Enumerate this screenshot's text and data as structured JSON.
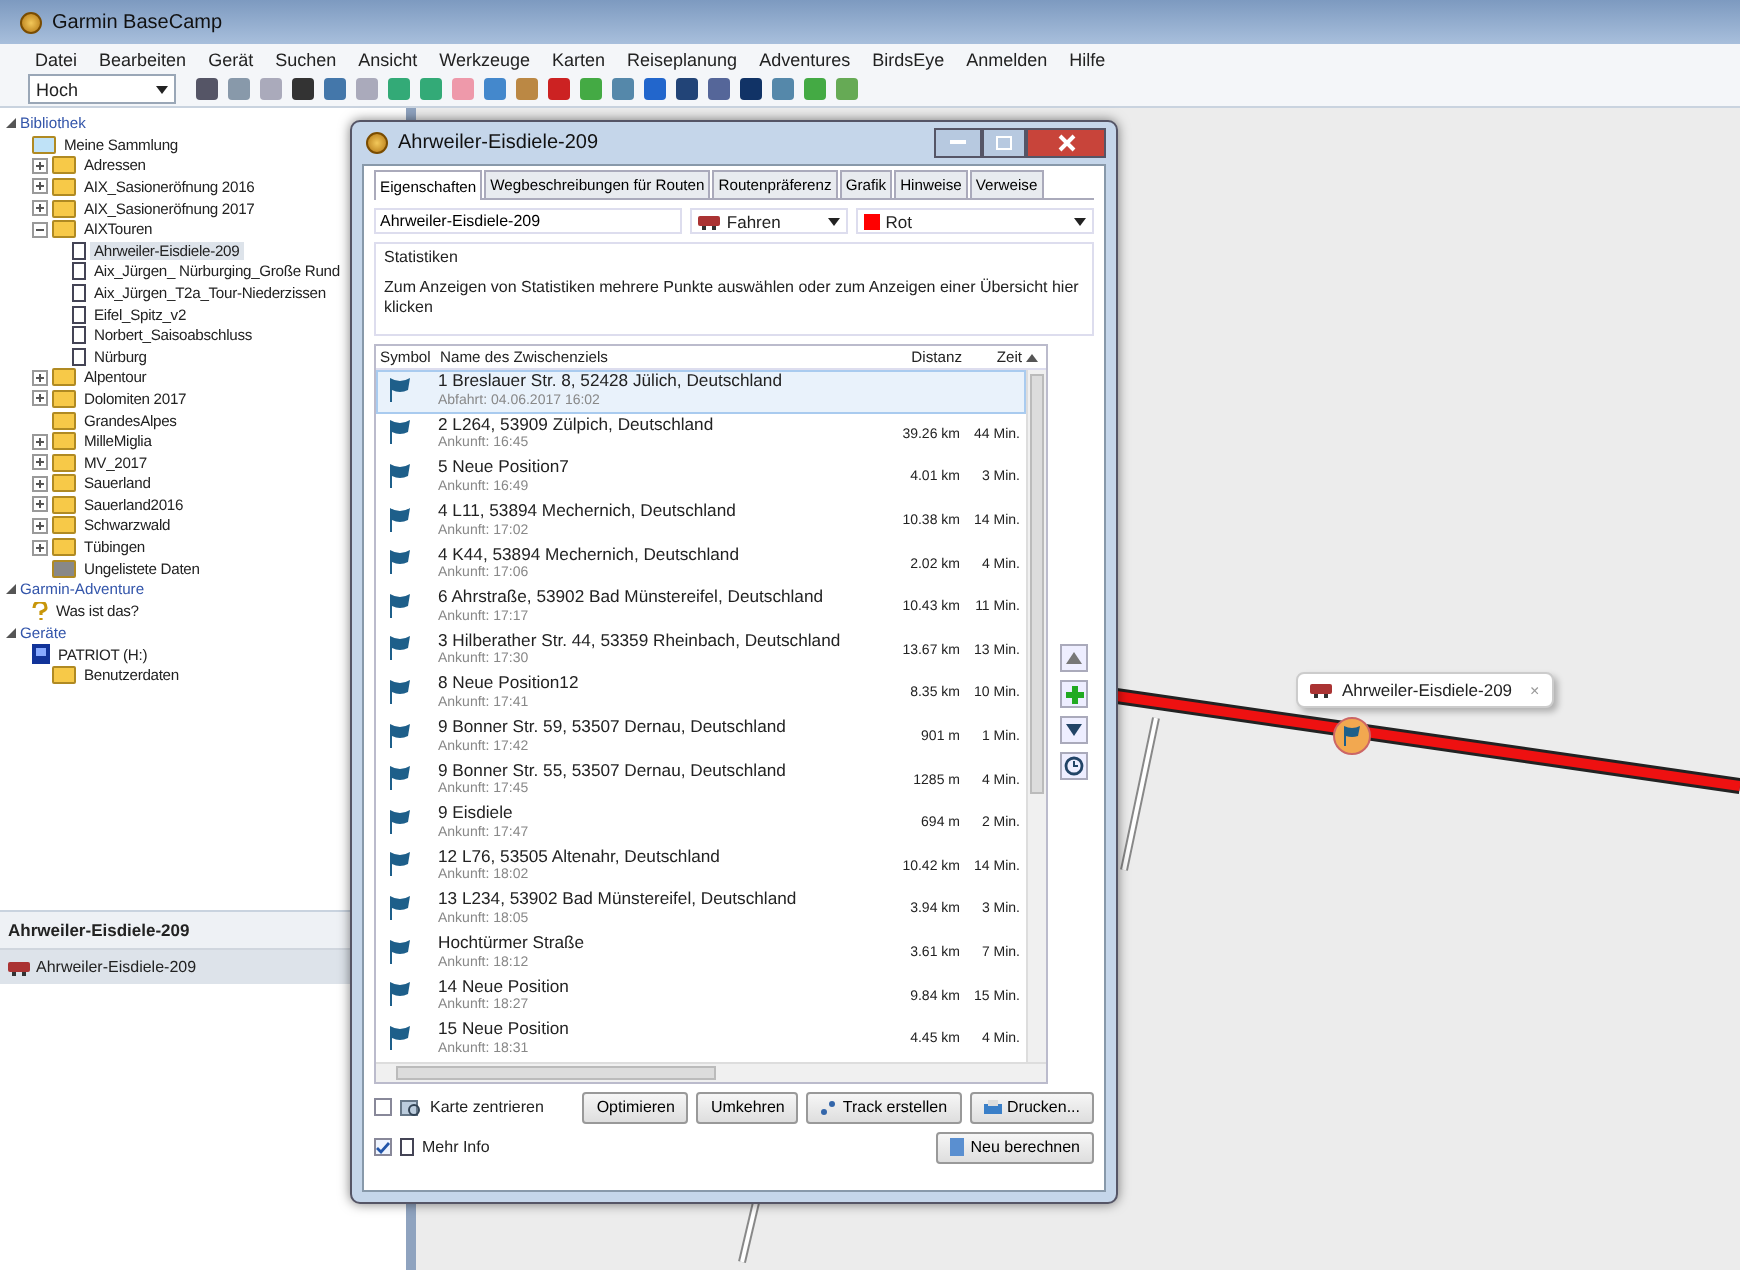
{
  "window": {
    "title": "Garmin BaseCamp"
  },
  "menu": [
    "Datei",
    "Bearbeiten",
    "Gerät",
    "Suchen",
    "Ansicht",
    "Werkzeuge",
    "Karten",
    "Reiseplanung",
    "Adventures",
    "BirdsEye",
    "Anmelden",
    "Hilfe"
  ],
  "toolbar": {
    "profile_select": "Hoch"
  },
  "sidebar": {
    "sections": [
      {
        "title": "Bibliothek",
        "items": [
          {
            "label": "Meine Sammlung",
            "kind": "collection",
            "selected": false,
            "children": [
              {
                "label": "Adressen",
                "kind": "folder",
                "expanded": false,
                "selected": false
              },
              {
                "label": "AIX_Sasioneröfnung 2016",
                "kind": "folder",
                "expanded": false,
                "selected": false
              },
              {
                "label": "AIX_Sasioneröfnung 2017",
                "kind": "folder",
                "expanded": false,
                "selected": false
              },
              {
                "label": "AIXTouren",
                "kind": "folder",
                "expanded": true,
                "selected": false,
                "children": [
                  {
                    "label": "Ahrweiler-Eisdiele-209",
                    "kind": "list",
                    "selected": true
                  },
                  {
                    "label": "Aix_Jürgen_ Nürburging_Große Rund",
                    "kind": "list",
                    "selected": false
                  },
                  {
                    "label": "Aix_Jürgen_T2a_Tour-Niederzissen",
                    "kind": "list",
                    "selected": false
                  },
                  {
                    "label": "Eifel_Spitz_v2",
                    "kind": "list",
                    "selected": false
                  },
                  {
                    "label": "Norbert_Saisoabschluss",
                    "kind": "list",
                    "selected": false
                  },
                  {
                    "label": "Nürburg",
                    "kind": "list",
                    "selected": false
                  }
                ]
              },
              {
                "label": "Alpentour",
                "kind": "folder",
                "expanded": false,
                "selected": false
              },
              {
                "label": "Dolomiten 2017",
                "kind": "folder",
                "expanded": false,
                "selected": false
              },
              {
                "label": "GrandesAlpes",
                "kind": "folder",
                "selected": false
              },
              {
                "label": "MilleMiglia",
                "kind": "folder",
                "expanded": false,
                "selected": false
              },
              {
                "label": "MV_2017",
                "kind": "folder",
                "expanded": false,
                "selected": false
              },
              {
                "label": "Sauerland",
                "kind": "folder",
                "expanded": false,
                "selected": false
              },
              {
                "label": "Sauerland2016",
                "kind": "folder",
                "expanded": false,
                "selected": false
              },
              {
                "label": "Schwarzwald",
                "kind": "folder",
                "expanded": false,
                "selected": false
              },
              {
                "label": "Tübingen",
                "kind": "folder",
                "expanded": false,
                "selected": false
              },
              {
                "label": "Ungelistete Daten",
                "kind": "unlisted",
                "selected": false
              }
            ]
          }
        ]
      },
      {
        "title": "Garmin-Adventure",
        "items": [
          {
            "label": "Was ist das?",
            "kind": "help",
            "selected": false
          }
        ]
      },
      {
        "title": "Geräte",
        "items": [
          {
            "label": "PATRIOT (H:)",
            "kind": "device",
            "selected": false,
            "children": [
              {
                "label": "Benutzerdaten",
                "kind": "folder",
                "selected": false
              }
            ]
          }
        ]
      }
    ]
  },
  "details": {
    "title": "Ahrweiler-Eisdiele-209",
    "item": "Ahrweiler-Eisdiele-209"
  },
  "map": {
    "popup": "Ahrweiler-Eisdiele-209",
    "popup_close": "×"
  },
  "dialog": {
    "title": "Ahrweiler-Eisdiele-209",
    "tabs": [
      {
        "label": "Eigenschaften",
        "selected": true
      },
      {
        "label": "Wegbeschreibungen für Routen",
        "selected": false
      },
      {
        "label": "Routenpräferenz",
        "selected": false
      },
      {
        "label": "Grafik",
        "selected": false
      },
      {
        "label": "Hinweise",
        "selected": false
      },
      {
        "label": "Verweise",
        "selected": false
      }
    ],
    "name": "Ahrweiler-Eisdiele-209",
    "activity": "Fahren",
    "color_name": "Rot",
    "statistics": {
      "title": "Statistiken",
      "text": "Zum Anzeigen von Statistiken mehrere Punkte auswählen oder zum Anzeigen einer Übersicht hier klicken"
    },
    "table": {
      "columns": [
        "Symbol",
        "Name des Zwischenziels",
        "Distanz",
        "Zeit"
      ],
      "rows": [
        {
          "name": "1 Breslauer Str. 8, 52428 Jülich, Deutschland",
          "info": "Abfahrt: 04.06.2017 16:02",
          "distance": "",
          "time": "",
          "selected": true
        },
        {
          "name": "2 L264, 53909 Zülpich, Deutschland",
          "info": "Ankunft: 16:45",
          "distance": "39.26 km",
          "time": "44 Min.",
          "selected": false
        },
        {
          "name": "5 Neue Position7",
          "info": "Ankunft: 16:49",
          "distance": "4.01 km",
          "time": "3 Min.",
          "selected": false
        },
        {
          "name": "4 L11, 53894 Mechernich, Deutschland",
          "info": "Ankunft: 17:02",
          "distance": "10.38 km",
          "time": "14 Min.",
          "selected": false
        },
        {
          "name": "4 K44, 53894 Mechernich, Deutschland",
          "info": "Ankunft: 17:06",
          "distance": "2.02 km",
          "time": "4 Min.",
          "selected": false
        },
        {
          "name": "6 Ahrstraße, 53902 Bad Münstereifel, Deutschland",
          "info": "Ankunft: 17:17",
          "distance": "10.43 km",
          "time": "11 Min.",
          "selected": false
        },
        {
          "name": "3 Hilberather Str. 44, 53359 Rheinbach, Deutschland",
          "info": "Ankunft: 17:30",
          "distance": "13.67 km",
          "time": "13 Min.",
          "selected": false
        },
        {
          "name": "8 Neue Position12",
          "info": "Ankunft: 17:41",
          "distance": "8.35 km",
          "time": "10 Min.",
          "selected": false
        },
        {
          "name": "9 Bonner Str. 59, 53507 Dernau, Deutschland",
          "info": "Ankunft: 17:42",
          "distance": "901 m",
          "time": "1 Min.",
          "selected": false
        },
        {
          "name": "9 Bonner Str. 55, 53507 Dernau, Deutschland",
          "info": "Ankunft: 17:45",
          "distance": "1285 m",
          "time": "4 Min.",
          "selected": false
        },
        {
          "name": "9 Eisdiele",
          "info": "Ankunft: 17:47",
          "distance": "694 m",
          "time": "2 Min.",
          "selected": false
        },
        {
          "name": "12 L76, 53505 Altenahr, Deutschland",
          "info": "Ankunft: 18:02",
          "distance": "10.42 km",
          "time": "14 Min.",
          "selected": false
        },
        {
          "name": "13 L234, 53902 Bad Münstereifel, Deutschland",
          "info": "Ankunft: 18:05",
          "distance": "3.94 km",
          "time": "3 Min.",
          "selected": false
        },
        {
          "name": "Hochtürmer Straße",
          "info": "Ankunft: 18:12",
          "distance": "3.61 km",
          "time": "7 Min.",
          "selected": false
        },
        {
          "name": "14 Neue Position",
          "info": "Ankunft: 18:27",
          "distance": "9.84 km",
          "time": "15 Min.",
          "selected": false
        },
        {
          "name": "15 Neue Position",
          "info": "Ankunft: 18:31",
          "distance": "4.45 km",
          "time": "4 Min.",
          "selected": false
        }
      ]
    },
    "center_map": {
      "label": "Karte zentrieren",
      "checked": false
    },
    "more_info": {
      "label": "Mehr Info",
      "checked": true
    },
    "buttons": [
      "Optimieren",
      "Umkehren",
      "Track erstellen",
      "Drucken..."
    ],
    "recalculate": "Neu berechnen"
  }
}
